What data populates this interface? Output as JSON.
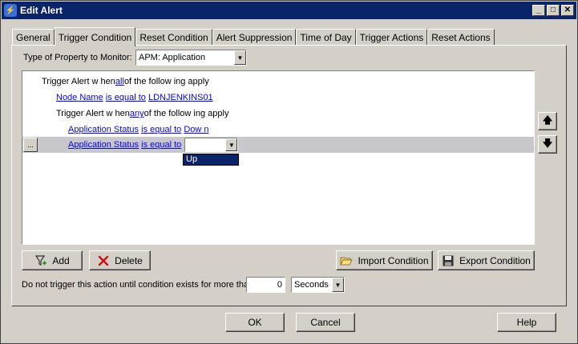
{
  "window": {
    "title": "Edit Alert"
  },
  "tabs": [
    {
      "label": "General"
    },
    {
      "label": "Trigger Condition"
    },
    {
      "label": "Reset Condition"
    },
    {
      "label": "Alert Suppression"
    },
    {
      "label": "Time of Day"
    },
    {
      "label": "Trigger Actions"
    },
    {
      "label": "Reset Actions"
    }
  ],
  "property": {
    "label": "Type of Property to Monitor:",
    "value": "APM: Application"
  },
  "conditions": {
    "row1": {
      "prefix": "Trigger Alert w hen ",
      "op": "all",
      "suffix": " of the follow ing apply"
    },
    "row2": {
      "field": "Node Name",
      "op": "is equal to",
      "value": "LDNJENKINS01"
    },
    "row3": {
      "prefix": "Trigger Alert w hen ",
      "op": "any",
      "suffix": " of the follow ing apply"
    },
    "row4": {
      "field": "Application Status",
      "op": "is equal to",
      "value": "Dow n"
    },
    "row5": {
      "field": "Application Status",
      "op": "is equal to",
      "value": ""
    },
    "dots_label": "...",
    "dropdown_option": "Up"
  },
  "buttons": {
    "add": "Add",
    "delete": "Delete",
    "import": "Import Condition",
    "export": "Export Condition",
    "ok": "OK",
    "cancel": "Cancel",
    "help": "Help"
  },
  "trigger_delay": {
    "label": "Do not trigger this action until condition exists for more than",
    "value": "0",
    "unit": "Seconds"
  }
}
